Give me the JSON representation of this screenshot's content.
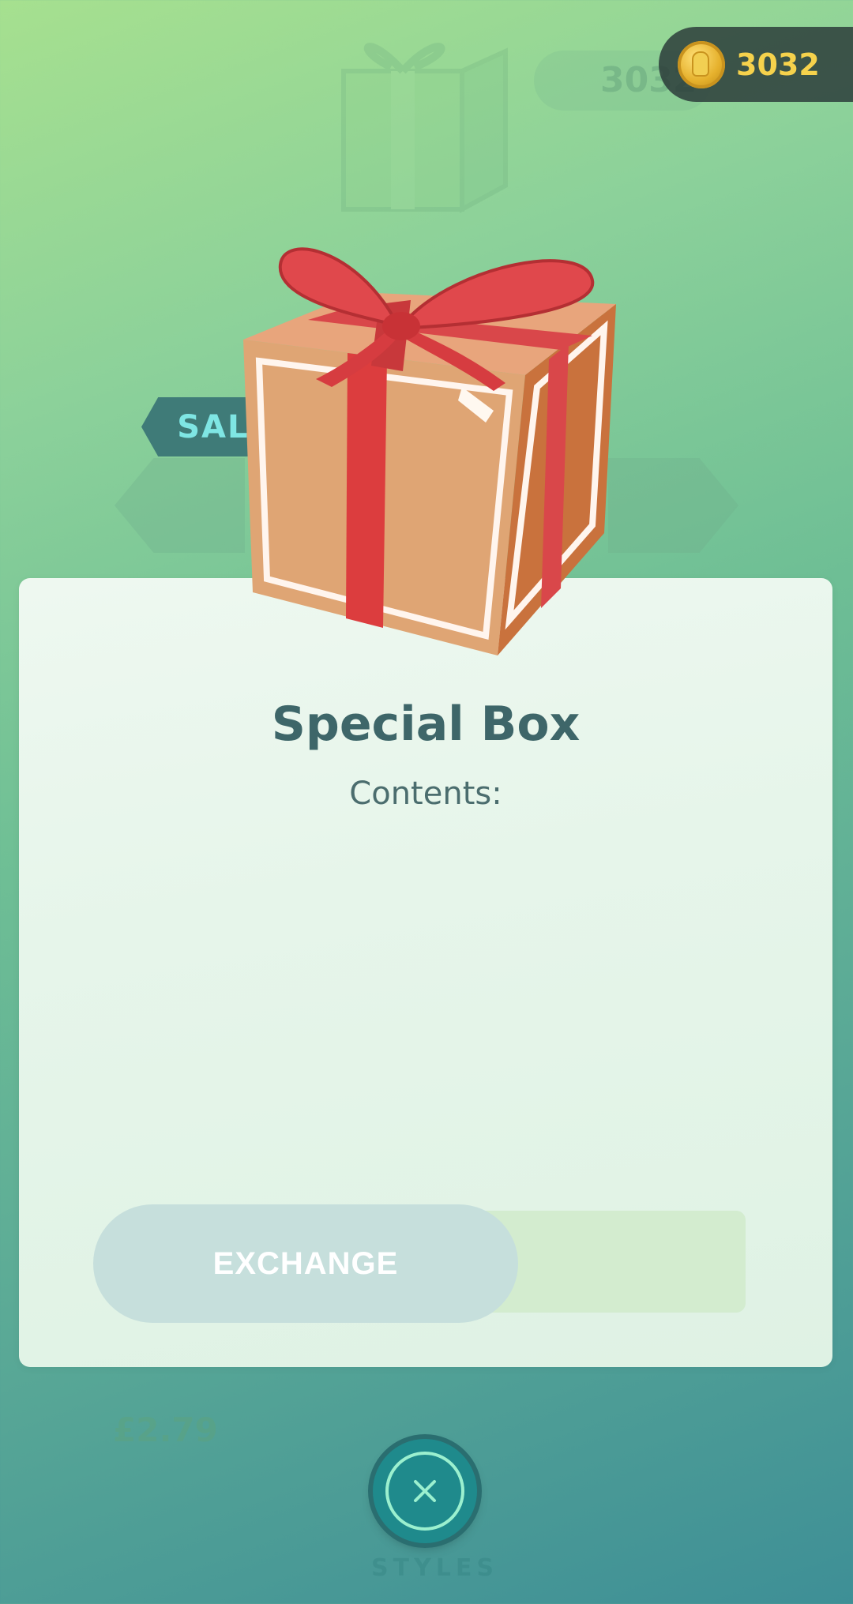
{
  "header": {
    "coin_count": "3032",
    "coin_icon": "pokecoin-icon"
  },
  "sale_badge": {
    "label": "SALE"
  },
  "item": {
    "image_icon": "gift-box-icon",
    "title": "Special Box",
    "contents_label": "Contents:"
  },
  "actions": {
    "exchange_label": "EXCHANGE",
    "close_icon": "close-icon"
  },
  "background": {
    "ghost_coin_count": "3032",
    "price": "£2.79",
    "styles_label": "STYLES"
  },
  "colors": {
    "coin_text": "#f6d24c",
    "sale_text": "#7fe6e4",
    "title_text": "#3e6669",
    "close_button": "#1f8a8c"
  }
}
